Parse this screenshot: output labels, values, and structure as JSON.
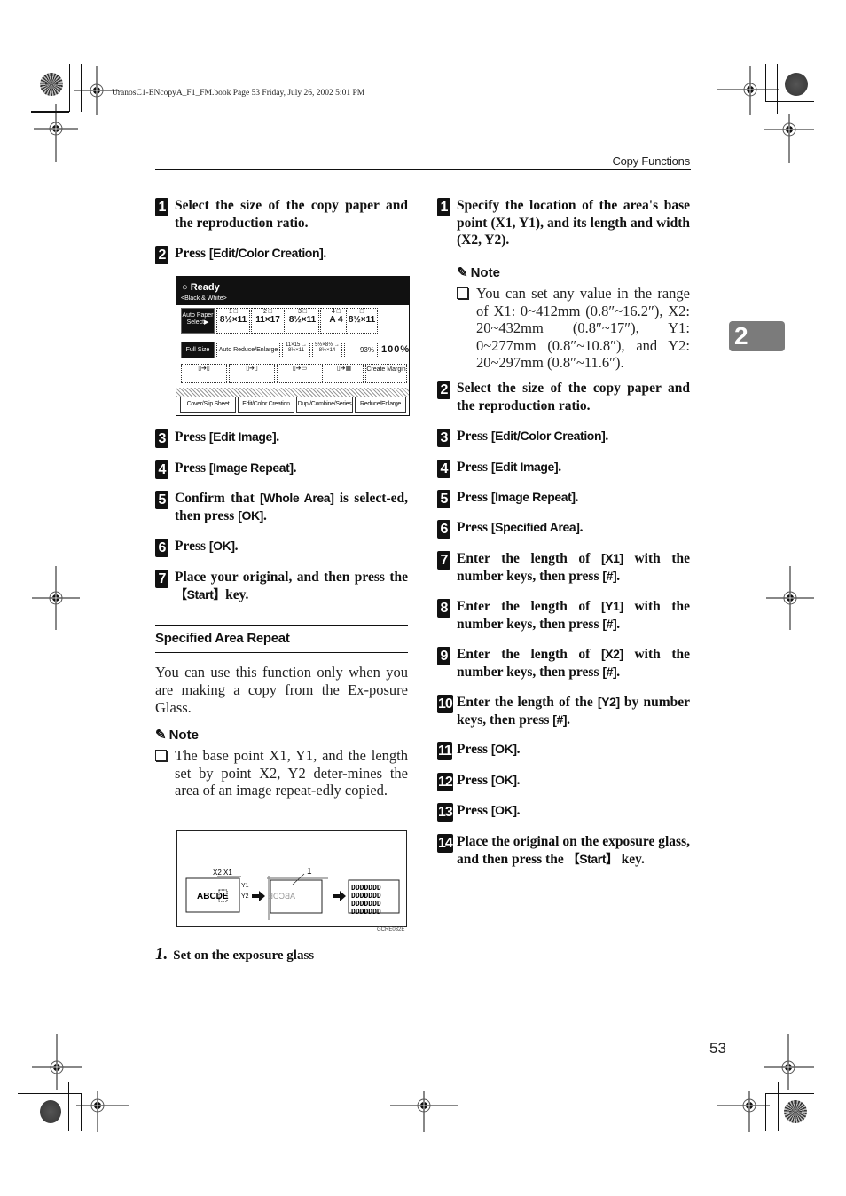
{
  "print_header": {
    "book_line": "UranosC1-ENcopyA_F1_FM.book  Page 53  Friday, July 26, 2002  5:01 PM"
  },
  "running_head": "Copy Functions",
  "chapter_tab": "2",
  "page_number": "53",
  "left_column": {
    "steps_a": [
      {
        "num": "1",
        "parts": [
          {
            "t": "Select the size of the copy paper and the reproduction ratio."
          }
        ]
      },
      {
        "num": "2",
        "parts": [
          {
            "t": "Press "
          },
          {
            "ui": "[Edit/Color Creation]"
          },
          {
            "t": "."
          }
        ]
      }
    ],
    "panel": {
      "status": "Ready",
      "mode": "<Black & White>",
      "paper_auto": "Auto Paper Select▶",
      "trays": [
        {
          "label": "1",
          "size": "8½×11"
        },
        {
          "label": "2",
          "size": "11×17"
        },
        {
          "label": "3",
          "size": "8½×11"
        },
        {
          "label": "4",
          "size": "A 4"
        },
        {
          "label": "",
          "size": "8½×11"
        }
      ],
      "full_size": "Full Size",
      "auto_reduce": "Auto Reduce/Enlarge",
      "preset1": "11×15 → 8½×11",
      "preset2": "5½×8½ → 8½×14",
      "preset3": "93%",
      "ratio": "100%",
      "create_margin": "Create Margin",
      "tabs": [
        "Cover/Slip Sheet",
        "Edit/Color Creation",
        "Dup./Combine/Series",
        "Reduce/Enlarge"
      ]
    },
    "steps_b": [
      {
        "num": "3",
        "parts": [
          {
            "t": "Press "
          },
          {
            "ui": "[Edit Image]"
          },
          {
            "t": "."
          }
        ]
      },
      {
        "num": "4",
        "parts": [
          {
            "t": "Press "
          },
          {
            "ui": "[Image Repeat]"
          },
          {
            "t": "."
          }
        ]
      },
      {
        "num": "5",
        "parts": [
          {
            "t": "Confirm that "
          },
          {
            "ui": "[Whole Area]"
          },
          {
            "t": " is select-ed, then press "
          },
          {
            "ui": "[OK]"
          },
          {
            "t": "."
          }
        ]
      },
      {
        "num": "6",
        "parts": [
          {
            "t": "Press "
          },
          {
            "ui": "[OK]"
          },
          {
            "t": "."
          }
        ]
      },
      {
        "num": "7",
        "parts": [
          {
            "t": "Place your original, and then press the "
          },
          {
            "ui": "【Start】"
          },
          {
            "t": "key."
          }
        ]
      }
    ],
    "section_title": "Specified Area Repeat",
    "intro": "You can use this function only when you are making a copy from the Ex-posure Glass.",
    "note_label": "Note",
    "note_item": "The base point X1, Y1, and the length set by point X2, Y2 deter-mines the area of an image repeat-edly copied.",
    "diagram": {
      "original_text": "ABCDE",
      "x_labels": "X2  X1",
      "y1": "Y1",
      "y2": "Y2",
      "callout": "1",
      "mirrored_text": "ABCDE",
      "tile_row": "DDDDDDD",
      "code": "GCRE032E"
    },
    "caption": {
      "num": "1.",
      "text": "Set on the exposure glass"
    }
  },
  "right_column": {
    "step1": {
      "num": "1",
      "parts": [
        {
          "t": "Specify the location of the area's base point (X1, Y1), and its length and width (X2, Y2)."
        }
      ]
    },
    "note_label": "Note",
    "note_item": "You can set any value in the range of X1: 0~412mm (0.8″~16.2″), X2: 20~432mm (0.8″~17″), Y1: 0~277mm (0.8″~10.8″), and Y2: 20~297mm (0.8″~11.6″).",
    "steps": [
      {
        "num": "2",
        "parts": [
          {
            "t": "Select the size of the copy paper and the reproduction ratio."
          }
        ]
      },
      {
        "num": "3",
        "parts": [
          {
            "t": "Press "
          },
          {
            "ui": "[Edit/Color Creation]"
          },
          {
            "t": "."
          }
        ]
      },
      {
        "num": "4",
        "parts": [
          {
            "t": "Press "
          },
          {
            "ui": "[Edit Image]"
          },
          {
            "t": "."
          }
        ]
      },
      {
        "num": "5",
        "parts": [
          {
            "t": "Press "
          },
          {
            "ui": "[Image Repeat]"
          },
          {
            "t": "."
          }
        ]
      },
      {
        "num": "6",
        "parts": [
          {
            "t": "Press "
          },
          {
            "ui": "[Specified Area]"
          },
          {
            "t": "."
          }
        ]
      },
      {
        "num": "7",
        "parts": [
          {
            "t": "Enter the length of "
          },
          {
            "ui": "[X1]"
          },
          {
            "t": " with the number keys, then press "
          },
          {
            "ui": "[#]"
          },
          {
            "t": "."
          }
        ]
      },
      {
        "num": "8",
        "parts": [
          {
            "t": "Enter the length of "
          },
          {
            "ui": "[Y1]"
          },
          {
            "t": " with the number keys, then press "
          },
          {
            "ui": "[#]"
          },
          {
            "t": "."
          }
        ]
      },
      {
        "num": "9",
        "parts": [
          {
            "t": "Enter the length of "
          },
          {
            "ui": "[X2]"
          },
          {
            "t": " with the number keys, then press "
          },
          {
            "ui": "[#]"
          },
          {
            "t": "."
          }
        ]
      },
      {
        "num": "10",
        "parts": [
          {
            "t": "Enter the length of the "
          },
          {
            "ui": "[Y2]"
          },
          {
            "t": " by number keys, then press "
          },
          {
            "ui": "[#]"
          },
          {
            "t": "."
          }
        ]
      },
      {
        "num": "11",
        "parts": [
          {
            "t": "Press "
          },
          {
            "ui": "[OK]"
          },
          {
            "t": "."
          }
        ]
      },
      {
        "num": "12",
        "parts": [
          {
            "t": "Press "
          },
          {
            "ui": "[OK]"
          },
          {
            "t": "."
          }
        ]
      },
      {
        "num": "13",
        "parts": [
          {
            "t": "Press "
          },
          {
            "ui": "[OK]"
          },
          {
            "t": "."
          }
        ]
      },
      {
        "num": "14",
        "parts": [
          {
            "t": "Place the original on the exposure glass, and then press the "
          },
          {
            "ui": "【Start】"
          },
          {
            "t": " key."
          }
        ]
      }
    ]
  }
}
